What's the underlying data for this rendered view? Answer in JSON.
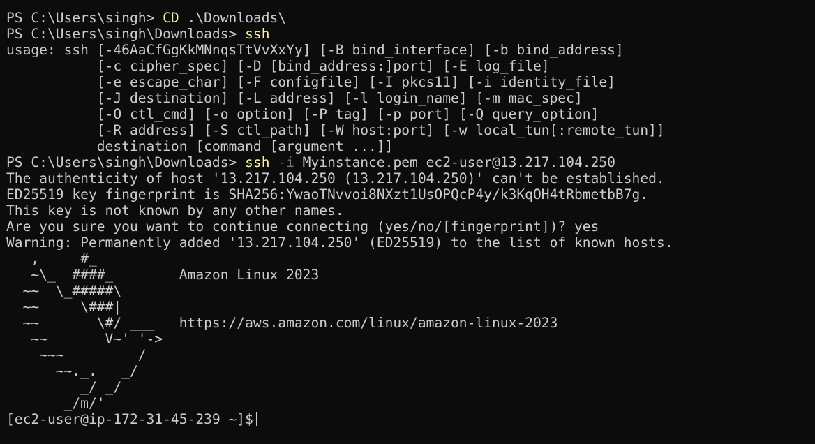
{
  "colors": {
    "background": "#0c0c0c",
    "text": "#cccccc",
    "command": "#f9f1a5",
    "parameter": "#767676"
  },
  "session": [
    {
      "type": "prompt",
      "prompt": "PS C:\\Users\\singh> ",
      "command": "CD",
      "args": " .\\Downloads\\"
    },
    {
      "type": "prompt",
      "prompt": "PS C:\\Users\\singh\\Downloads> ",
      "command": "ssh"
    },
    {
      "type": "output",
      "text": "usage: ssh [-46AaCfGgKkMNnqsTtVvXxYy] [-B bind_interface] [-b bind_address]"
    },
    {
      "type": "output",
      "text": "           [-c cipher_spec] [-D [bind_address:]port] [-E log_file]"
    },
    {
      "type": "output",
      "text": "           [-e escape_char] [-F configfile] [-I pkcs11] [-i identity_file]"
    },
    {
      "type": "output",
      "text": "           [-J destination] [-L address] [-l login_name] [-m mac_spec]"
    },
    {
      "type": "output",
      "text": "           [-O ctl_cmd] [-o option] [-P tag] [-p port] [-Q query_option]"
    },
    {
      "type": "output",
      "text": "           [-R address] [-S ctl_path] [-W host:port] [-w local_tun[:remote_tun]]"
    },
    {
      "type": "output",
      "text": "           destination [command [argument ...]]"
    },
    {
      "type": "prompt",
      "prompt": "PS C:\\Users\\singh\\Downloads> ",
      "command": "ssh",
      "param": " -i",
      "args": " Myinstance.pem ec2-user@13.217.104.250"
    },
    {
      "type": "output",
      "text": "The authenticity of host '13.217.104.250 (13.217.104.250)' can't be established."
    },
    {
      "type": "output",
      "text": "ED25519 key fingerprint is SHA256:YwaoTNvvoi8NXzt1UsOPQcP4y/k3KqOH4tRbmetbB7g."
    },
    {
      "type": "output",
      "text": "This key is not known by any other names."
    },
    {
      "type": "output",
      "text": "Are you sure you want to continue connecting (yes/no/[fingerprint])? yes"
    },
    {
      "type": "output",
      "text": "Warning: Permanently added '13.217.104.250' (ED25519) to the list of known hosts."
    },
    {
      "type": "output",
      "text": "   ,     #_"
    },
    {
      "type": "output",
      "text": "   ~\\_  ####_        Amazon Linux 2023"
    },
    {
      "type": "output",
      "text": "  ~~  \\_#####\\"
    },
    {
      "type": "output",
      "text": "  ~~     \\###|"
    },
    {
      "type": "output",
      "text": "  ~~       \\#/ ___   https://aws.amazon.com/linux/amazon-linux-2023"
    },
    {
      "type": "output",
      "text": "   ~~       V~' '->"
    },
    {
      "type": "output",
      "text": "    ~~~         /"
    },
    {
      "type": "output",
      "text": "      ~~._.   _/"
    },
    {
      "type": "output",
      "text": "         _/ _/"
    },
    {
      "type": "output",
      "text": "       _/m/'"
    }
  ],
  "current_prompt": "[ec2-user@ip-172-31-45-239 ~]$"
}
